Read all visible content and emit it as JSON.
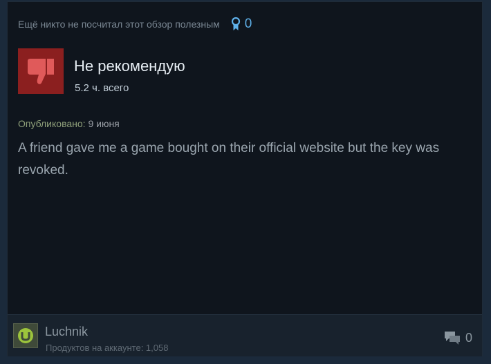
{
  "review": {
    "helpful_text": "Ещё никто не посчитал этот обзор полезным",
    "awards_count": "0",
    "verdict": "Не рекомендую",
    "hours": "5.2 ч. всего",
    "posted_label": "Опубликовано:",
    "posted_date": "9 июня",
    "text": "A friend gave me a game bought on their official website but the key was revoked."
  },
  "author": {
    "name": "Luchnik",
    "products": "Продуктов на аккаунте: 1,058"
  },
  "comments_count": "0",
  "icons": {
    "verdict": "thumbs-down-icon",
    "award": "award-ribbon-icon",
    "comments": "comment-bubbles-icon",
    "avatar": "utorrent-logo-icon"
  },
  "colors": {
    "card_bg": "#0f151d",
    "page_bg": "#1b2a3b",
    "thumb_bg": "#8b1f1f",
    "thumb_fg": "#e05a5a",
    "award_blue": "#5fb1ea"
  }
}
